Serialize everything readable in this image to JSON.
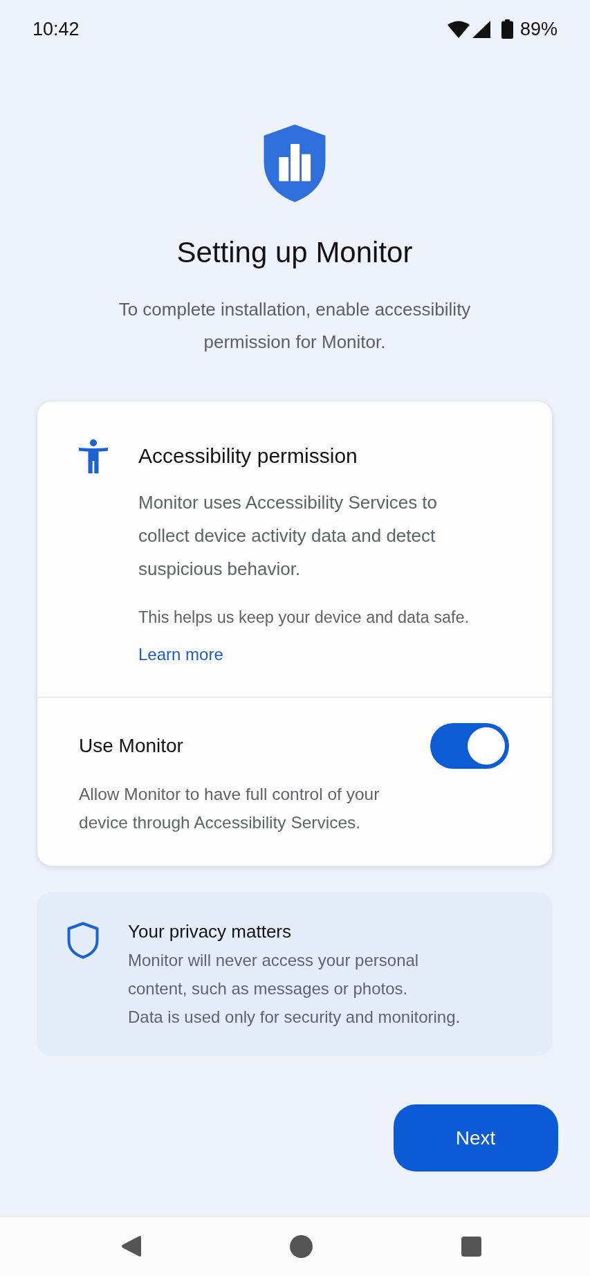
{
  "status_bar": {
    "time": "10:42",
    "battery": "89%"
  },
  "header": {
    "title": "Setting up Monitor",
    "subtitle": "To complete installation, enable accessibility permission for Monitor."
  },
  "permission_card": {
    "title": "Accessibility permission",
    "description": "Monitor uses Accessibility Services to collect device activity data and detect suspicious behavior.",
    "note": "This helps us keep your device and data safe.",
    "link": "Learn more",
    "setting": {
      "label": "Use Monitor",
      "on": true,
      "description": "Allow Monitor to have full control of your device through Accessibility Services."
    }
  },
  "privacy_notice": {
    "title": "Your privacy matters",
    "paragraphs": [
      "Monitor will never access your personal content, such as messages or photos.",
      "Data is used only for security and monitoring."
    ]
  },
  "next_button": {
    "label": "Next"
  }
}
